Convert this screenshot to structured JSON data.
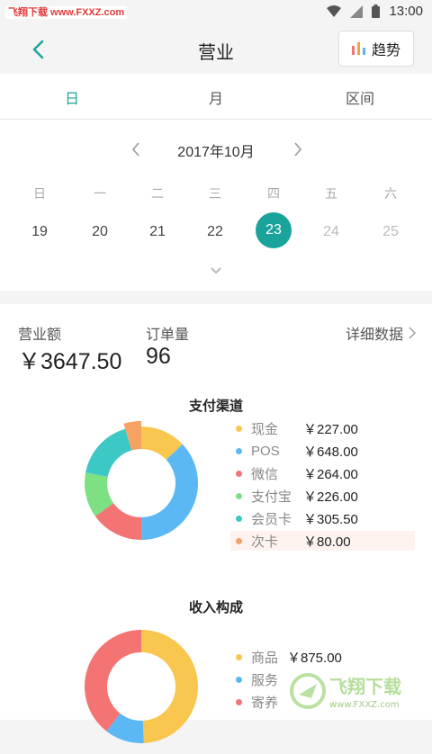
{
  "watermark_top": "飞翔下载 www.FXXZ.com",
  "status": {
    "time": "13:00"
  },
  "header": {
    "title": "营业",
    "trend_label": "趋势"
  },
  "tabs": [
    {
      "label": "日"
    },
    {
      "label": "月"
    },
    {
      "label": "区间"
    }
  ],
  "calendar": {
    "month": "2017年10月",
    "weekdays": [
      "日",
      "一",
      "二",
      "三",
      "四",
      "五",
      "六"
    ],
    "days": [
      "19",
      "20",
      "21",
      "22",
      "23",
      "24",
      "25"
    ],
    "selected_day": "23"
  },
  "summary": {
    "revenue_label": "营业额",
    "revenue_value": "￥3647.50",
    "orders_label": "订单量",
    "orders_value": "96",
    "detail_link": "详细数据"
  },
  "payment": {
    "title": "支付渠道",
    "items": [
      {
        "label": "现金",
        "value": "￥227.00",
        "color": "#f9c74f"
      },
      {
        "label": "POS",
        "value": "￥648.00",
        "color": "#5bb8f5"
      },
      {
        "label": "微信",
        "value": "￥264.00",
        "color": "#f47474"
      },
      {
        "label": "支付宝",
        "value": "￥226.00",
        "color": "#7de082"
      },
      {
        "label": "会员卡",
        "value": "￥305.50",
        "color": "#3cc8c4"
      },
      {
        "label": "次卡",
        "value": "￥80.00",
        "color": "#f5a262"
      }
    ]
  },
  "income": {
    "title": "收入构成",
    "items": [
      {
        "label": "商品",
        "value": "￥875.00",
        "color": "#f9c74f"
      },
      {
        "label": "服务",
        "value": "",
        "color": "#5bb8f5"
      },
      {
        "label": "寄养",
        "value": "",
        "color": "#f47474"
      }
    ]
  },
  "watermark_bottom": {
    "brand": "飞翔下载",
    "url": "www.FXXZ.com"
  },
  "chart_data": [
    {
      "type": "pie",
      "title": "支付渠道",
      "categories": [
        "现金",
        "POS",
        "微信",
        "支付宝",
        "会员卡",
        "次卡"
      ],
      "values": [
        227.0,
        648.0,
        264.0,
        226.0,
        305.5,
        80.0
      ]
    },
    {
      "type": "pie",
      "title": "收入构成",
      "categories": [
        "商品",
        "服务",
        "寄养"
      ],
      "values": [
        875.0,
        200,
        700
      ]
    }
  ]
}
